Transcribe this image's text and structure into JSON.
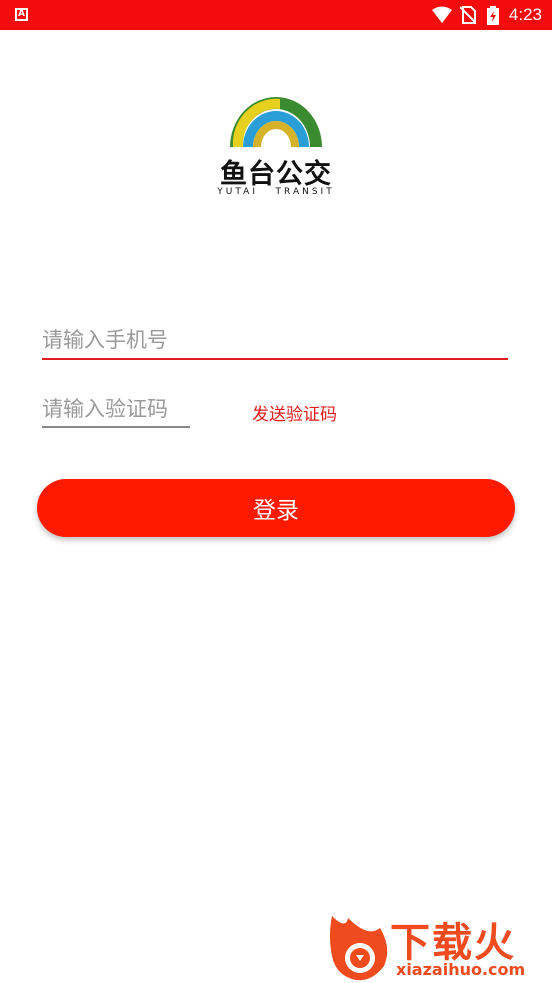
{
  "status_bar": {
    "time": "4:23",
    "app_badge": "A"
  },
  "logo": {
    "title": "鱼台公交",
    "subtitle": "YUTAI   TRANSIT"
  },
  "form": {
    "phone_placeholder": "请输入手机号",
    "code_placeholder": "请输入验证码",
    "send_code_label": "发送验证码",
    "login_label": "登录"
  },
  "colors": {
    "accent": "#ff1a00",
    "status_bar": "#f40b0b"
  },
  "watermark": {
    "text": "下载火",
    "url": "xiazaihuo.com"
  }
}
